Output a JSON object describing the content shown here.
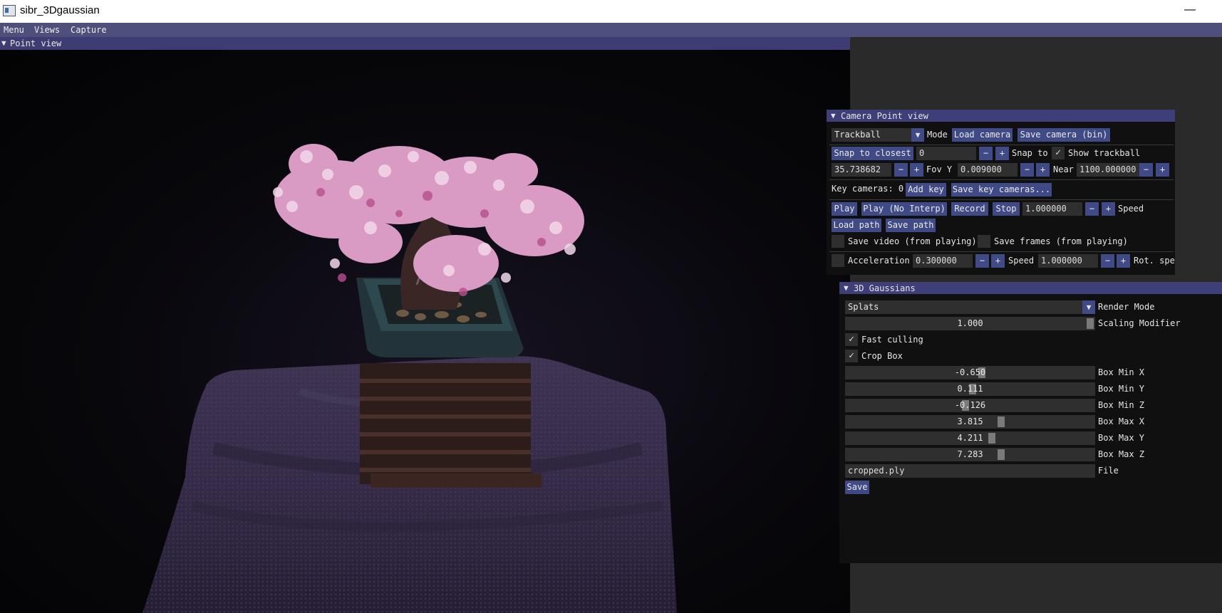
{
  "window": {
    "title": "sibr_3Dgaussian",
    "minimize_symbol": "—"
  },
  "menubar": {
    "items": [
      "Menu",
      "Views",
      "Capture"
    ]
  },
  "point_view": {
    "title": "Point view",
    "collapse_icon": "▼"
  },
  "camera_panel": {
    "title": "Camera Point view",
    "collapse_icon": "▼",
    "mode_value": "Trackball",
    "dropdown_icon": "▼",
    "mode_label": "Mode",
    "load_camera": "Load camera",
    "save_camera": "Save camera (bin)",
    "snap_to_closest": "Snap to closest",
    "snap_value": "0",
    "minus": "−",
    "plus": "+",
    "snap_to_label": "Snap to",
    "show_trackball_label": "Show trackball",
    "show_trackball_checked": true,
    "check_mark": "✓",
    "fovy_value": "35.738682",
    "fovy_label": "Fov Y",
    "near_value": "0.009000",
    "near_label": "Near",
    "far_value": "1100.000000",
    "key_cameras_label": "Key cameras: 0",
    "add_key": "Add key",
    "save_key_cameras": "Save key cameras...",
    "play": "Play",
    "play_no_interp": "Play (No Interp)",
    "record": "Record",
    "stop": "Stop",
    "play_speed_value": "1.000000",
    "speed_label": "Speed",
    "load_path": "Load path",
    "save_path": "Save path",
    "save_video_label": "Save video (from playing)",
    "save_frames_label": "Save frames (from playing)",
    "acceleration_label": "Acceleration",
    "acceleration_value": "0.300000",
    "speed2_label": "Speed",
    "speed2_value": "1.000000",
    "rot_speed_label": "Rot. spe"
  },
  "gaussians_panel": {
    "title": "3D Gaussians",
    "collapse_icon": "▼",
    "render_mode_value": "Splats",
    "dropdown_icon": "▼",
    "render_mode_label": "Render Mode",
    "scaling_modifier_value": "1.000",
    "scaling_modifier_level": 1.0,
    "scaling_modifier_label": "Scaling Modifier",
    "fast_culling_label": "Fast culling",
    "fast_culling_checked": true,
    "crop_box_label": "Crop Box",
    "crop_box_checked": true,
    "check_mark": "✓",
    "sliders": [
      {
        "value": "-0.650",
        "label": "Box Min X",
        "level": 0.55
      },
      {
        "value": "0.111",
        "label": "Box Min Y",
        "level": 0.51
      },
      {
        "value": "-0.126",
        "label": "Box Min Z",
        "level": 0.48
      },
      {
        "value": "3.815",
        "label": "Box Max X",
        "level": 0.63
      },
      {
        "value": "4.211",
        "label": "Box Max Y",
        "level": 0.59
      },
      {
        "value": "7.283",
        "label": "Box Max Z",
        "level": 0.63
      }
    ],
    "file_value": "cropped.ply",
    "file_label": "File",
    "save": "Save"
  }
}
